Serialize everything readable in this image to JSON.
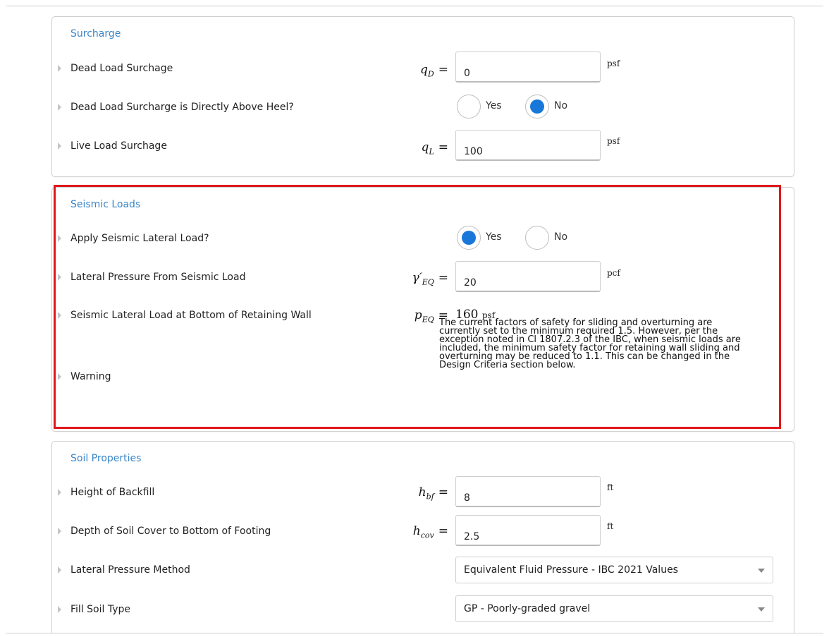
{
  "surcharge": {
    "title": "Surcharge",
    "dead_load": {
      "label": "Dead Load Surchage",
      "var": "q",
      "sub": "D",
      "value": "0",
      "unit": "psf"
    },
    "above_heel": {
      "label": "Dead Load Surcharge is Directly Above Heel?",
      "yes": "Yes",
      "no": "No",
      "selected": "No"
    },
    "live_load": {
      "label": "Live Load Surchage",
      "var": "q",
      "sub": "L",
      "value": "100",
      "unit": "psf"
    }
  },
  "seismic": {
    "title": "Seismic Loads",
    "apply": {
      "label": "Apply Seismic Lateral Load?",
      "yes": "Yes",
      "no": "No",
      "selected": "Yes"
    },
    "pressure": {
      "label": "Lateral Pressure From Seismic Load",
      "var": "γ′",
      "sub": "EQ",
      "value": "20",
      "unit": "pcf"
    },
    "bottom_load": {
      "label": "Seismic Lateral Load at Bottom of Retaining Wall",
      "var": "p",
      "sub": "EQ",
      "value": "160",
      "unit": "psf"
    },
    "warning": {
      "label": "Warning",
      "text": "The current factors of safety for sliding and overturning are currently set to the minimum required 1.5. However, per the exception noted in Cl 1807.2.3 of the IBC, when seismic loads are included, the minimum safety factor for retaining wall sliding and overturning may be reduced to 1.1. This can be changed in the Design Criteria section below."
    }
  },
  "soil": {
    "title": "Soil Properties",
    "height_backfill": {
      "label": "Height of Backfill",
      "var": "h",
      "sub": "bf",
      "value": "8",
      "unit": "ft"
    },
    "depth_cover": {
      "label": "Depth of Soil Cover to Bottom of Footing",
      "var": "h",
      "sub": "cov",
      "value": "2.5",
      "unit": "ft"
    },
    "pressure_method": {
      "label": "Lateral Pressure Method",
      "value": "Equivalent Fluid Pressure - IBC 2021 Values"
    },
    "fill_soil_type": {
      "label": "Fill Soil Type",
      "value": "GP - Poorly-graded gravel"
    }
  },
  "equals": "="
}
